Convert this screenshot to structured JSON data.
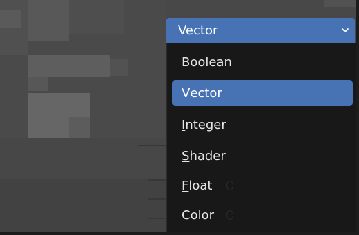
{
  "dropdown": {
    "selected_value": "Vector",
    "icon": "chevron-down-icon",
    "accent_color": "#4772b3",
    "options": [
      {
        "first": "B",
        "rest": "oolean"
      },
      {
        "first": "V",
        "rest": "ector"
      },
      {
        "first": "I",
        "rest": "nteger"
      },
      {
        "first": "S",
        "rest": "hader"
      },
      {
        "first": "F",
        "rest": "loat"
      },
      {
        "first": "C",
        "rest": "olor"
      }
    ]
  }
}
